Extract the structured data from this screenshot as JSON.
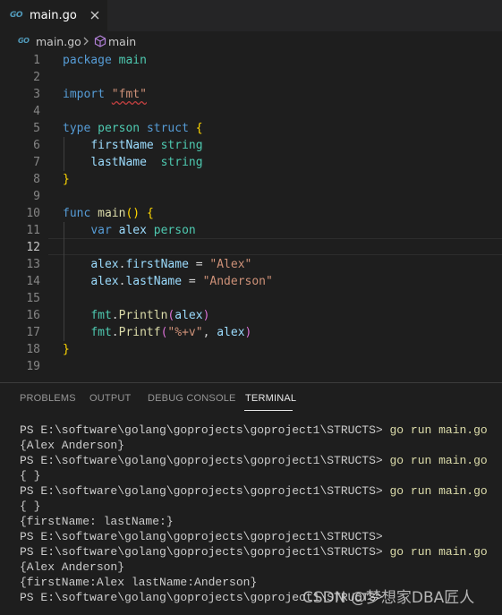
{
  "tab": {
    "icon_text": "GO",
    "label": "main.go"
  },
  "breadcrumb": {
    "icon_text": "GO",
    "file": "main.go",
    "symbol": "main"
  },
  "editor": {
    "line_numbers": [
      "1",
      "2",
      "3",
      "4",
      "5",
      "6",
      "7",
      "8",
      "9",
      "10",
      "11",
      "12",
      "13",
      "14",
      "15",
      "16",
      "17",
      "18",
      "19"
    ],
    "active_line": "12"
  },
  "panel": {
    "tabs": [
      "PROBLEMS",
      "OUTPUT",
      "DEBUG CONSOLE",
      "TERMINAL"
    ],
    "active_tab": "TERMINAL"
  },
  "terminal": {
    "prompt": "PS E:\\software\\golang\\goprojects\\goproject1\\STRUCTS>",
    "command": "go run main.go",
    "outputs": [
      "{Alex Anderson}",
      "{ }",
      "{ }",
      "{firstName: lastName:}",
      "{Alex Anderson}",
      "{firstName:Alex lastName:Anderson}"
    ]
  },
  "watermark": "CSDN @梦想家DBA匠人",
  "colors": {
    "keyword": "#569cd6",
    "type": "#4ec9b0",
    "function": "#dcdcaa",
    "variable": "#9cdcfe",
    "string": "#ce9178",
    "go_icon": "#519aba"
  }
}
